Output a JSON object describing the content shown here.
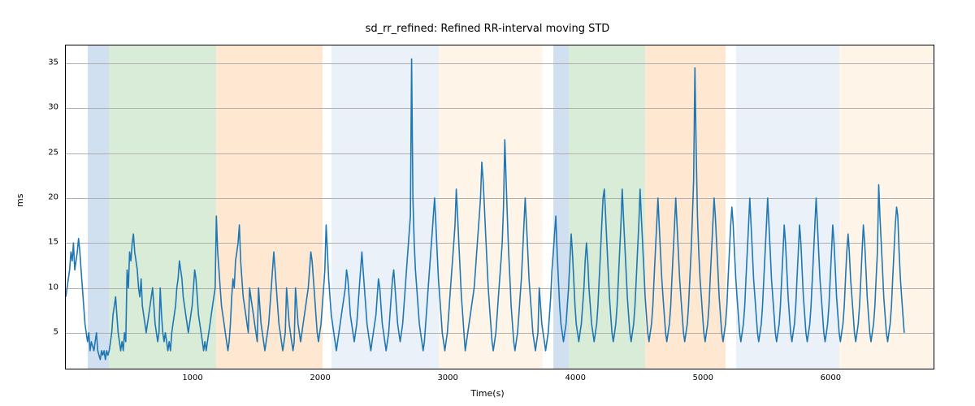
{
  "chart_data": {
    "type": "line",
    "title": "sd_rr_refined: Refined RR-interval moving STD",
    "xlabel": "Time(s)",
    "ylabel": "ms",
    "xlim": [
      0,
      6800
    ],
    "ylim": [
      1,
      37
    ],
    "xticks": [
      1000,
      2000,
      3000,
      4000,
      5000,
      6000
    ],
    "yticks": [
      5,
      10,
      15,
      20,
      25,
      30,
      35
    ],
    "background_regions": [
      {
        "x0": 170,
        "x1": 340,
        "color": "#6699cc"
      },
      {
        "x0": 340,
        "x1": 1180,
        "color": "#7fbf7f"
      },
      {
        "x0": 1180,
        "x1": 2010,
        "color": "#ffb266"
      },
      {
        "x0": 2010,
        "x1": 2080,
        "color": "#ffffff"
      },
      {
        "x0": 2080,
        "x1": 2920,
        "color": "#bcd2e8"
      },
      {
        "x0": 2920,
        "x1": 3740,
        "color": "#ffd9b3"
      },
      {
        "x0": 3740,
        "x1": 3820,
        "color": "#ffffff"
      },
      {
        "x0": 3820,
        "x1": 3940,
        "color": "#6699cc"
      },
      {
        "x0": 3940,
        "x1": 4540,
        "color": "#7fbf7f"
      },
      {
        "x0": 4540,
        "x1": 5170,
        "color": "#ffb266"
      },
      {
        "x0": 5170,
        "x1": 5250,
        "color": "#ffffff"
      },
      {
        "x0": 5250,
        "x1": 6060,
        "color": "#bcd2e8"
      },
      {
        "x0": 6060,
        "x1": 6800,
        "color": "#ffd9b3"
      }
    ],
    "series": [
      {
        "name": "sd_rr_refined",
        "color": "#1f77b4",
        "x_start": 0,
        "x_step": 10,
        "y": [
          9,
          10,
          11,
          12,
          14,
          13,
          15,
          12,
          13,
          14,
          15.5,
          14,
          12,
          10,
          8,
          6,
          5,
          4,
          5,
          3,
          4,
          3.5,
          3,
          4,
          5,
          3,
          2.5,
          2,
          3,
          2.5,
          3,
          2,
          3,
          2.5,
          3,
          4,
          5,
          7,
          8,
          9,
          7,
          5,
          4,
          3,
          4,
          3,
          5,
          4,
          12,
          10,
          14,
          13,
          15,
          16,
          14,
          13,
          12,
          10,
          9,
          11,
          8,
          7,
          6,
          5,
          6,
          7,
          8,
          9,
          10,
          8,
          6,
          5,
          4,
          5,
          10,
          7,
          5,
          4,
          5,
          4,
          3,
          4,
          3,
          5,
          6,
          7,
          8,
          10,
          11,
          13,
          12,
          11,
          9,
          8,
          7,
          6,
          5,
          6,
          7,
          8,
          10,
          12,
          11,
          9,
          7,
          6,
          5,
          4,
          3,
          4,
          3,
          4,
          5,
          6,
          7,
          8,
          9,
          10,
          18,
          14,
          12,
          10,
          8,
          7,
          6,
          5,
          4,
          3,
          4,
          6,
          9,
          11,
          10,
          13,
          14,
          15,
          17,
          13,
          11,
          9,
          8,
          7,
          6,
          5,
          10,
          9,
          8,
          7,
          6,
          5,
          4,
          10,
          8,
          6,
          5,
          4,
          3,
          4,
          5,
          6,
          8,
          10,
          12,
          14,
          12,
          10,
          8,
          6,
          5,
          4,
          3,
          4,
          5,
          10,
          8,
          6,
          5,
          4,
          3,
          4,
          10,
          8,
          6,
          5,
          4,
          5,
          6,
          7,
          8,
          9,
          10,
          12,
          14,
          13,
          11,
          9,
          7,
          5,
          4,
          5,
          6,
          8,
          10,
          12,
          17,
          14,
          11,
          9,
          7,
          6,
          5,
          4,
          3,
          4,
          5,
          6,
          7,
          8,
          9,
          10,
          12,
          11,
          9,
          7,
          6,
          5,
          4,
          5,
          6,
          8,
          10,
          12,
          14,
          12,
          10,
          8,
          6,
          5,
          4,
          3,
          4,
          5,
          6,
          7,
          9,
          11,
          10,
          8,
          6,
          5,
          4,
          3,
          4,
          5,
          7,
          9,
          11,
          12,
          10,
          8,
          6,
          5,
          4,
          5,
          6,
          8,
          10,
          12,
          14,
          16,
          18,
          35.5,
          20,
          15,
          12,
          10,
          8,
          6,
          5,
          4,
          3,
          4,
          6,
          8,
          10,
          12,
          14,
          16,
          18,
          20,
          17,
          14,
          11,
          9,
          7,
          5,
          4,
          3,
          4,
          5,
          7,
          9,
          11,
          13,
          15,
          17,
          21,
          18,
          15,
          12,
          9,
          7,
          5,
          3,
          4,
          5,
          6,
          7,
          8,
          9,
          10,
          12,
          14,
          16,
          18,
          20,
          24,
          22,
          19,
          16,
          13,
          10,
          8,
          6,
          4,
          3,
          4,
          5,
          7,
          9,
          11,
          13,
          15,
          19,
          26.5,
          22,
          18,
          14,
          11,
          8,
          6,
          4,
          3,
          4,
          5,
          7,
          9,
          11,
          14,
          17,
          20,
          17,
          14,
          11,
          9,
          7,
          5,
          4,
          3,
          4,
          5,
          10,
          8,
          6,
          5,
          4,
          3,
          4,
          5,
          7,
          9,
          12,
          14,
          16,
          18,
          14,
          11,
          8,
          6,
          5,
          4,
          5,
          6,
          8,
          10,
          13,
          16,
          14,
          11,
          8,
          6,
          5,
          4,
          5,
          6,
          8,
          10,
          13,
          15,
          13,
          10,
          8,
          6,
          5,
          4,
          5,
          6,
          8,
          11,
          14,
          17,
          20,
          21,
          18,
          15,
          12,
          9,
          7,
          5,
          4,
          5,
          6,
          8,
          11,
          14,
          17,
          21,
          18,
          15,
          12,
          9,
          7,
          5,
          4,
          5,
          6,
          8,
          11,
          14,
          17,
          21,
          18,
          15,
          12,
          9,
          7,
          5,
          4,
          5,
          6,
          8,
          11,
          14,
          17,
          20,
          17,
          14,
          11,
          9,
          7,
          5,
          4,
          5,
          6,
          8,
          11,
          14,
          17,
          20,
          17,
          14,
          11,
          9,
          7,
          5,
          4,
          5,
          6,
          8,
          11,
          14,
          18,
          22,
          34.5,
          25,
          18,
          14,
          11,
          9,
          7,
          5,
          4,
          5,
          6,
          8,
          11,
          14,
          17,
          20,
          18,
          15,
          12,
          9,
          7,
          5,
          4,
          5,
          6,
          8,
          11,
          14,
          17,
          19,
          17,
          14,
          11,
          9,
          7,
          5,
          4,
          5,
          6,
          8,
          11,
          14,
          17,
          20,
          17,
          14,
          11,
          9,
          7,
          5,
          4,
          5,
          6,
          8,
          11,
          14,
          17,
          20,
          17,
          14,
          11,
          9,
          7,
          5,
          4,
          5,
          6,
          8,
          11,
          14,
          17,
          15,
          12,
          9,
          7,
          5,
          4,
          5,
          6,
          8,
          11,
          14,
          17,
          15,
          12,
          9,
          7,
          5,
          4,
          5,
          6,
          8,
          11,
          14,
          17,
          20,
          17,
          14,
          11,
          9,
          7,
          5,
          4,
          5,
          6,
          8,
          11,
          14,
          17,
          15,
          12,
          9,
          7,
          5,
          4,
          5,
          6,
          8,
          11,
          14,
          16,
          14,
          11,
          9,
          7,
          5,
          4,
          5,
          6,
          8,
          11,
          14,
          17,
          15,
          12,
          9,
          7,
          5,
          4,
          5,
          6,
          8,
          11,
          14,
          21.5,
          18,
          15,
          12,
          9,
          7,
          5,
          4,
          5,
          6,
          8,
          11,
          14,
          17,
          19,
          18,
          14,
          11,
          9,
          7,
          5
        ]
      }
    ]
  }
}
